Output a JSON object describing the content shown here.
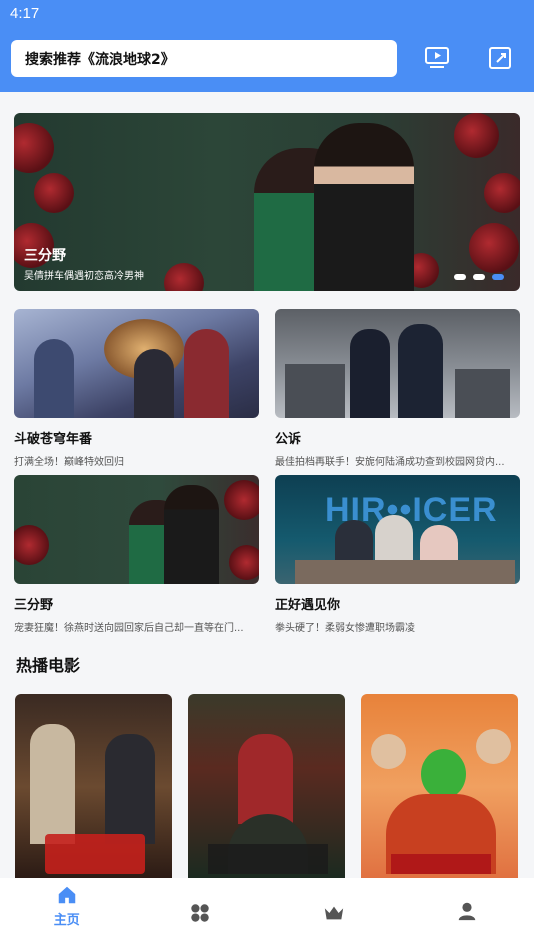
{
  "status_bar": {
    "time": "4:17"
  },
  "header": {
    "search_placeholder": "搜索推荐《流浪地球2》",
    "icons": [
      "play-screen-icon",
      "history-icon"
    ],
    "color": "#4a8ef5"
  },
  "banner": {
    "title": "三分野",
    "subtitle": "吴倩拼车偶遇初恋高冷男神",
    "page_count": 3,
    "active_page": 3
  },
  "grid": [
    {
      "title": "斗破苍穹年番",
      "desc": "打满全场！巅峰特效回归"
    },
    {
      "title": "公诉",
      "desc": "最佳拍档再联手！安旎何陆涌成功查到校园网贷内..."
    },
    {
      "title": "三分野",
      "desc": "宠妻狂魔！徐燕时送向园回家后自己却一直等在门..."
    },
    {
      "title": "正好遇见你",
      "desc": "拳头硬了！柔弱女惨遭职场霸凌"
    }
  ],
  "hot_movies": {
    "title": "热播电影"
  },
  "bottom_nav": [
    {
      "label": "主页",
      "icon": "home-icon",
      "active": true
    },
    {
      "label": "",
      "icon": "category-icon",
      "active": false
    },
    {
      "label": "",
      "icon": "crown-icon",
      "active": false
    },
    {
      "label": "",
      "icon": "user-icon",
      "active": false
    }
  ]
}
